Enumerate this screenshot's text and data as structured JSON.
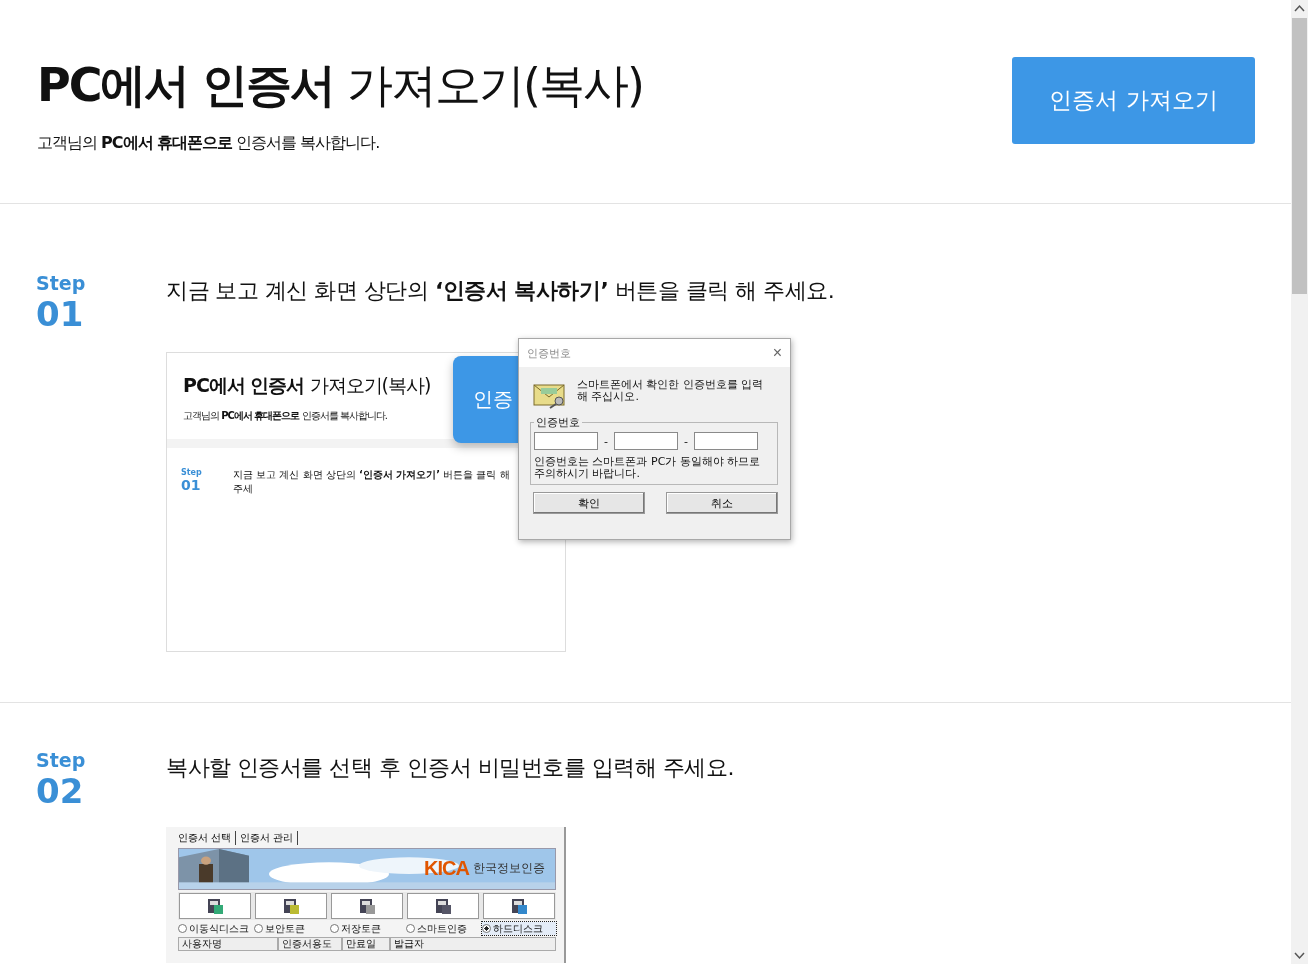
{
  "header": {
    "title": "**PC에서 인증서** 가져오기(복사)",
    "subtitle": "고객님의 **PC에서 휴대폰으로** 인증서를 복사합니다.",
    "button": "인증서 가져오기"
  },
  "steps": [
    {
      "label": "Step",
      "number": "01",
      "instruction": "지금 보고 계신 화면 상단의 **‘인증서 복사하기’** 버튼을 클릭 해 주세요.",
      "screenshot": {
        "kind": "page_with_dialog",
        "page": {
          "title": "**PC에서 인증서** 가져오기(복사)",
          "subtitle": "고객님의 **PC에서 휴대폰으로** 인증서를 복사합니다.",
          "button": "인증",
          "step_label": "Step",
          "step_number": "01",
          "instruction": "지금 보고 계신 화면 상단의 **‘인증서 가져오기’** 버튼을 클릭 해 주세"
        },
        "dialog": {
          "title": "인증번호",
          "close": "×",
          "message": "스마트폰에서 확인한 인증번호를 입력해 주십시오.",
          "group_label": "인증번호",
          "separator": "-",
          "note": "인증번호는 스마트폰과 PC가 동일해야 하므로 주의하시기 바랍니다.",
          "buttons": [
            "확인",
            "취소"
          ]
        }
      }
    },
    {
      "label": "Step",
      "number": "02",
      "instruction": "복사할 인증서를 선택 후 인증서 비밀번호를 입력해 주세요.",
      "screenshot": {
        "kind": "cert_selector",
        "tabs": [
          "인증서 선택",
          "인증서 관리"
        ],
        "banner": {
          "logo": "KICA",
          "company": "한국정보인증"
        },
        "locations": [
          {
            "label": "이동식디스크",
            "selected": false
          },
          {
            "label": "보안토큰",
            "selected": false
          },
          {
            "label": "저장토큰",
            "selected": false
          },
          {
            "label": "스마트인증",
            "selected": false
          },
          {
            "label": "하드디스크",
            "selected": true
          }
        ],
        "columns": [
          "사용자명",
          "인증서용도",
          "만료일",
          "발급자"
        ]
      }
    }
  ]
}
